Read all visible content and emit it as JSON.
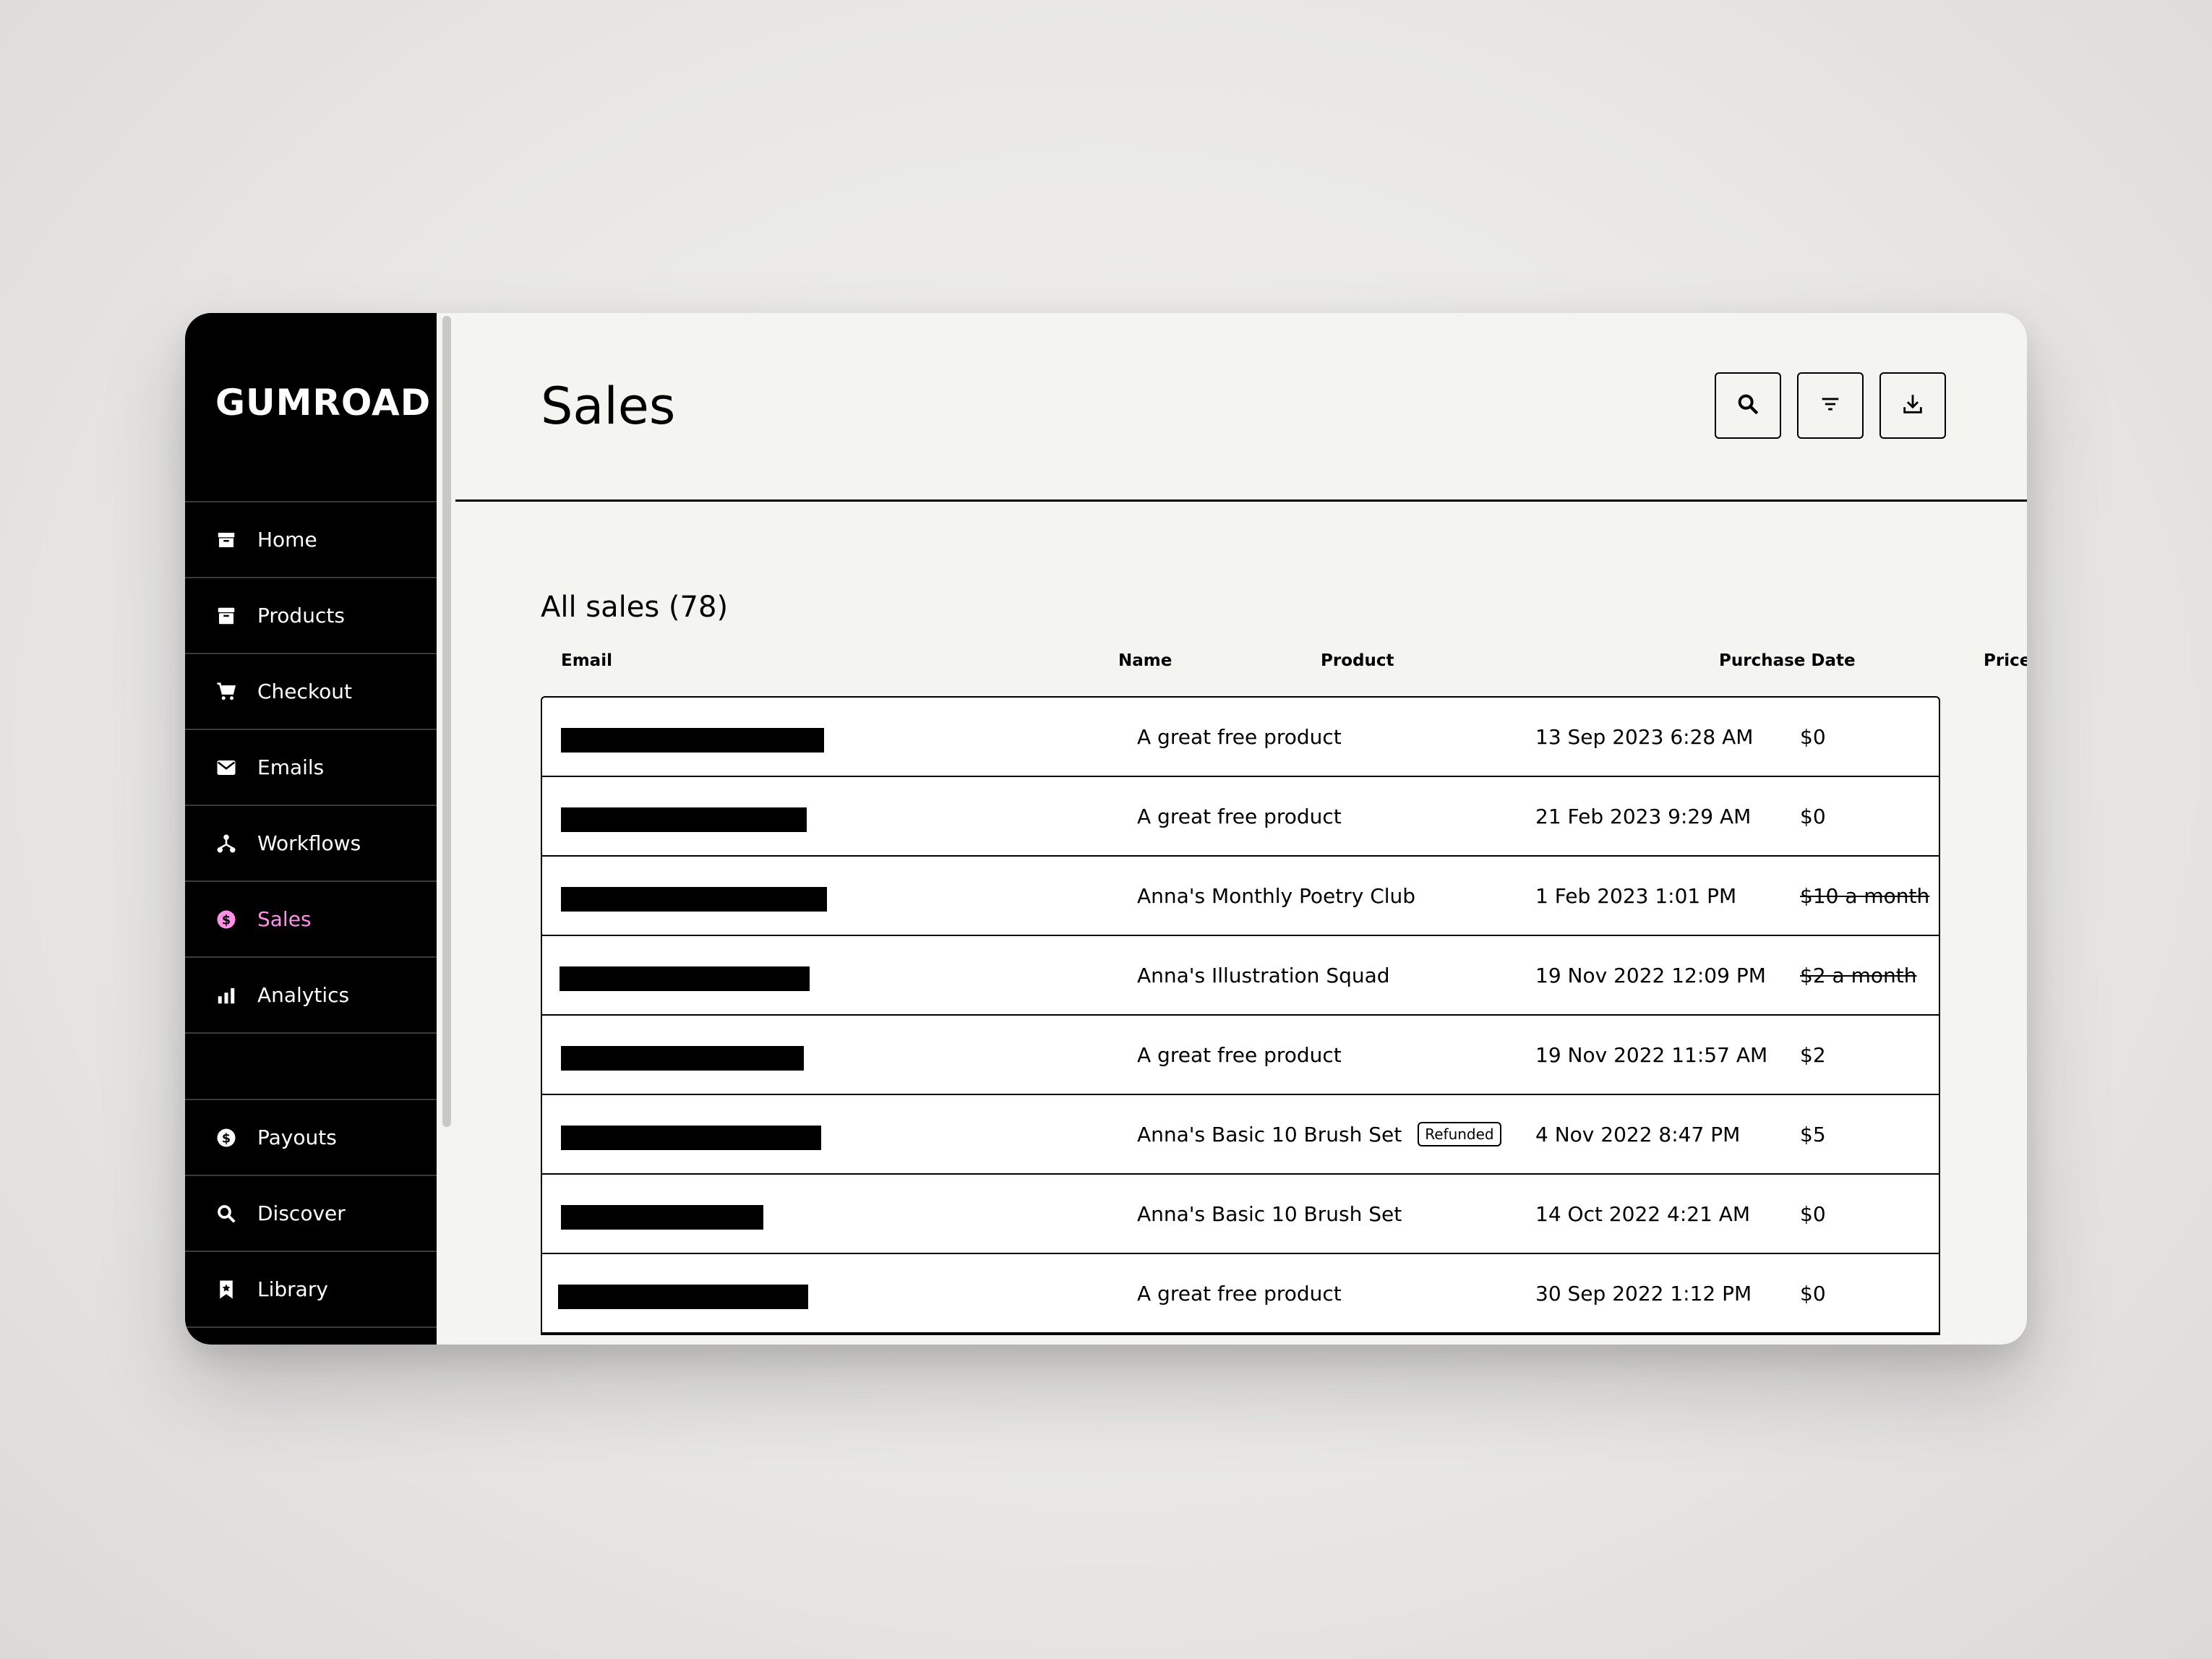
{
  "brand": {
    "logo_text": "GUMROAD"
  },
  "sidebar": {
    "items": [
      {
        "label": "Home",
        "icon": "home-icon"
      },
      {
        "label": "Products",
        "icon": "archive-icon"
      },
      {
        "label": "Checkout",
        "icon": "cart-icon"
      },
      {
        "label": "Emails",
        "icon": "envelope-icon"
      },
      {
        "label": "Workflows",
        "icon": "workflow-icon"
      },
      {
        "label": "Sales",
        "icon": "dollar-circle-icon",
        "active": true
      },
      {
        "label": "Analytics",
        "icon": "bar-chart-icon"
      }
    ],
    "bottom_items": [
      {
        "label": "Payouts",
        "icon": "dollar-circle-icon"
      },
      {
        "label": "Discover",
        "icon": "search-icon"
      },
      {
        "label": "Library",
        "icon": "bookmark-icon"
      }
    ]
  },
  "header": {
    "title": "Sales",
    "actions": [
      "search-icon",
      "filter-icon",
      "download-icon"
    ]
  },
  "table": {
    "title": "All sales (78)",
    "columns": [
      "Email",
      "Name",
      "Product",
      "Purchase Date",
      "Price"
    ],
    "rows": [
      {
        "email": "[redacted]",
        "name": "",
        "product": "A great free product",
        "badge": "",
        "date": "13 Sep 2023 6:28 AM",
        "price": "$0",
        "struck": false
      },
      {
        "email": "[redacted]",
        "name": "",
        "product": "A great free product",
        "badge": "",
        "date": "21 Feb 2023 9:29 AM",
        "price": "$0",
        "struck": false
      },
      {
        "email": "[redacted]",
        "name": "",
        "product": "Anna's Monthly Poetry Club",
        "badge": "",
        "date": "1 Feb 2023 1:01 PM",
        "price": "$10 a month",
        "struck": true
      },
      {
        "email": "[redacted]",
        "name": "",
        "product": "Anna's Illustration Squad",
        "badge": "",
        "date": "19 Nov 2022 12:09 PM",
        "price": "$2 a month",
        "struck": true
      },
      {
        "email": "[redacted]",
        "name": "",
        "product": "A great free product",
        "badge": "",
        "date": "19 Nov 2022 11:57 AM",
        "price": "$2",
        "struck": false
      },
      {
        "email": "[redacted]",
        "name": "",
        "product": "Anna's Basic 10 Brush Set",
        "badge": "Refunded",
        "date": "4 Nov 2022 8:47 PM",
        "price": "$5",
        "struck": false
      },
      {
        "email": "[redacted]",
        "name": "",
        "product": "Anna's Basic 10 Brush Set",
        "badge": "",
        "date": "14 Oct 2022 4:21 AM",
        "price": "$0",
        "struck": false
      },
      {
        "email": "[redacted]",
        "name": "",
        "product": "A great free product",
        "badge": "",
        "date": "30 Sep 2022 1:12 PM",
        "price": "$0",
        "struck": false
      }
    ]
  },
  "colors": {
    "active_nav": "#ff90e8",
    "sidebar_bg": "#000000",
    "content_bg": "#f4f4f0"
  }
}
